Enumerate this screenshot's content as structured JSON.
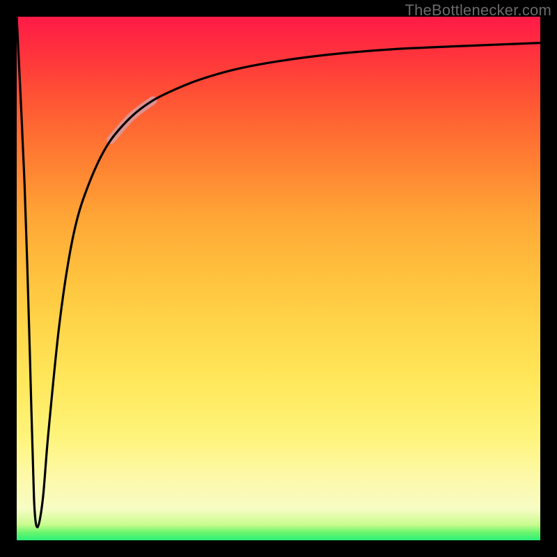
{
  "watermark": {
    "text": "TheBottlenecker.com"
  },
  "chart_data": {
    "type": "line",
    "title": "",
    "xlabel": "",
    "ylabel": "",
    "xlim": [
      0,
      100
    ],
    "ylim": [
      0,
      100
    ],
    "description": "Bottleneck percentage curve with highlighted uncertainty band",
    "series": [
      {
        "name": "bottleneck-curve",
        "x": [
          0,
          1.5,
          2.5,
          3.3,
          4,
          5,
          6,
          8,
          10,
          12,
          15,
          18,
          22,
          26,
          30,
          35,
          42,
          50,
          60,
          72,
          85,
          100
        ],
        "y": [
          100,
          68,
          36,
          8,
          2.5,
          8,
          20,
          40,
          54,
          63,
          71,
          76.5,
          81,
          84,
          86,
          88,
          90,
          91.5,
          92.8,
          93.8,
          94.4,
          95
        ]
      }
    ],
    "highlight_segment": {
      "note": "faded pink band over portion of the curve near the knee",
      "x_range": [
        18,
        26
      ],
      "y_range": [
        76.5,
        84
      ]
    },
    "gradient_stops_bottom_to_top": [
      {
        "pos": 0.0,
        "color": "#2cf07a"
      },
      {
        "pos": 0.015,
        "color": "#6bf56e"
      },
      {
        "pos": 0.03,
        "color": "#c9fb8e"
      },
      {
        "pos": 0.06,
        "color": "#f7fcc4"
      },
      {
        "pos": 0.12,
        "color": "#fdf9a9"
      },
      {
        "pos": 0.2,
        "color": "#fef47a"
      },
      {
        "pos": 0.3,
        "color": "#ffe85c"
      },
      {
        "pos": 0.4,
        "color": "#ffd74a"
      },
      {
        "pos": 0.5,
        "color": "#ffc33e"
      },
      {
        "pos": 0.62,
        "color": "#ffa536"
      },
      {
        "pos": 0.72,
        "color": "#ff8132"
      },
      {
        "pos": 0.82,
        "color": "#ff5d33"
      },
      {
        "pos": 0.92,
        "color": "#ff363b"
      },
      {
        "pos": 1.0,
        "color": "#ff1a47"
      }
    ]
  }
}
